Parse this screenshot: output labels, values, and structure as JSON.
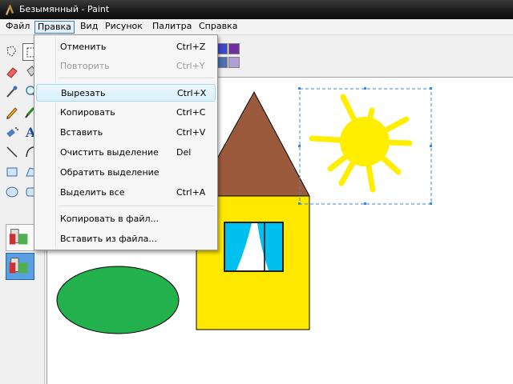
{
  "window": {
    "title": "Безымянный - Paint"
  },
  "menubar": {
    "items": [
      {
        "label": "Файл"
      },
      {
        "label": "Правка"
      },
      {
        "label": "Вид"
      },
      {
        "label": "Рисунок"
      },
      {
        "label": "Палитра"
      },
      {
        "label": "Справка"
      }
    ],
    "active": "Правка"
  },
  "edit_menu": {
    "items": [
      {
        "label": "Отменить",
        "shortcut": "Ctrl+Z",
        "enabled": true
      },
      {
        "label": "Повторить",
        "shortcut": "Ctrl+Y",
        "enabled": false
      },
      {
        "label": "Вырезать",
        "shortcut": "Ctrl+X",
        "enabled": true,
        "highlighted": true
      },
      {
        "label": "Копировать",
        "shortcut": "Ctrl+C",
        "enabled": true
      },
      {
        "label": "Вставить",
        "shortcut": "Ctrl+V",
        "enabled": true
      },
      {
        "label": "Очистить выделение",
        "shortcut": "Del",
        "enabled": true
      },
      {
        "label": "Обратить выделение",
        "shortcut": "",
        "enabled": true
      },
      {
        "label": "Выделить все",
        "shortcut": "Ctrl+A",
        "enabled": true
      },
      {
        "label": "Копировать в файл...",
        "shortcut": "",
        "enabled": true
      },
      {
        "label": "Вставить из файла...",
        "shortcut": "",
        "enabled": true
      }
    ]
  },
  "toolbox": {
    "tools": [
      "free-select-icon",
      "rect-select-icon",
      "eraser-icon",
      "fill-bucket-icon",
      "color-picker-icon",
      "magnifier-icon",
      "pencil-icon",
      "brush-icon",
      "airbrush-icon",
      "text-icon",
      "line-icon",
      "curve-icon",
      "rectangle-icon",
      "polygon-icon",
      "ellipse-icon",
      "rounded-rect-icon"
    ],
    "options": [
      "opaque-selection-icon",
      "transparent-selection-icon"
    ],
    "selected_option": "transparent-selection-icon"
  },
  "colors": {
    "house_wall": "#ffe800",
    "roof": "#9c5a3c",
    "window_glass": "#00c0f0",
    "sun": "#ffee00",
    "ellipse": "#22b14c",
    "selection_border": "#3a8ad8",
    "palette": [
      "#3f48cc",
      "#7030a0",
      "#5070b0",
      "#b0a0d8"
    ]
  }
}
